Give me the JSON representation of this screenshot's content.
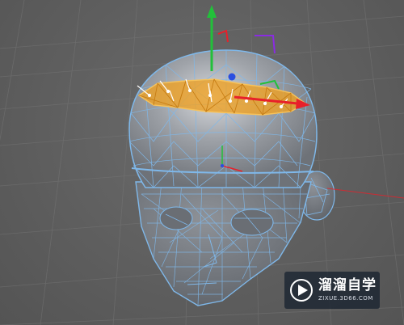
{
  "viewport": {
    "background_color": "#5f5f5f",
    "grid_color": "#747474",
    "mesh_color": "#7fb8ea",
    "selection_color": "#f0a020",
    "axis_x_color": "#e8202a",
    "axis_y_color": "#22c03a",
    "axis_z_color": "#2a4fe0",
    "gizmo_plane_color": "#8a2be2"
  },
  "watermark": {
    "logo": "play-icon",
    "name": "溜溜自学",
    "url": "ZIXUE.3D66.COM"
  }
}
